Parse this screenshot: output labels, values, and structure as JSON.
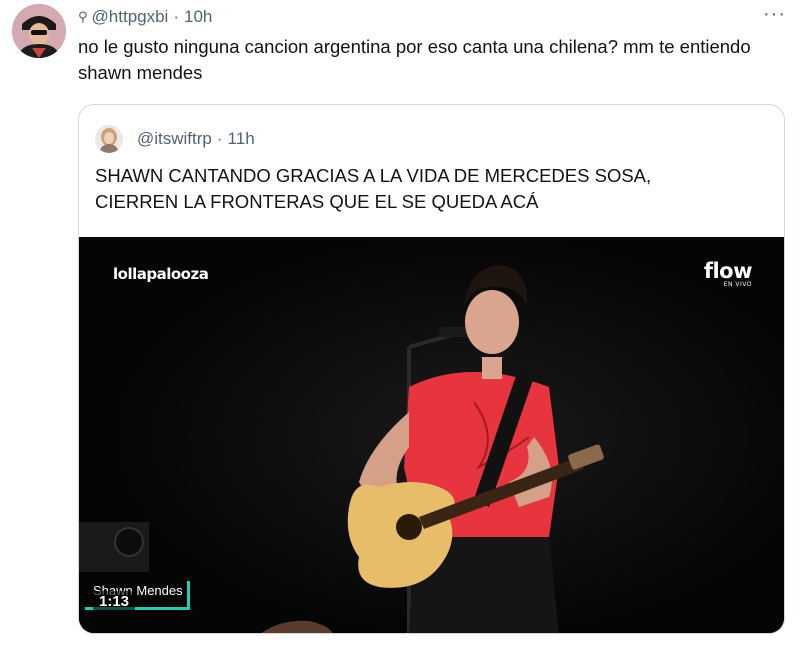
{
  "tweet": {
    "pin_icon": "unpin-glyph",
    "handle": "@httpgxbi",
    "time": "10h",
    "separator": "·",
    "more": "···",
    "text": "no le gusto ninguna cancion argentina por eso canta una chilena? mm te entiendo shawn mendes"
  },
  "quote": {
    "handle": "@itswiftrp",
    "time": "11h",
    "separator": "·",
    "text_line1": "SHAWN CANTANDO GRACIAS A LA VIDA DE MERCEDES SOSA,",
    "text_line2": "CIERREN LA FRONTERAS QUE EL SE QUEDA ACÁ"
  },
  "video": {
    "logo_left": "lollapalooza",
    "logo_right": "flow",
    "logo_right_sub": "EN VIVO",
    "lower_third": "Shawn Mendes",
    "duration": "1:13",
    "accent_color": "#1ecfb5"
  }
}
